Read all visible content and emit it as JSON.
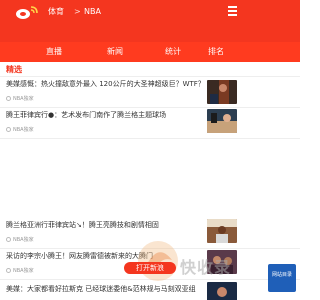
{
  "header": {
    "breadcrumb_section": "体育",
    "breadcrumb_separator": ">",
    "breadcrumb_current": "NBA"
  },
  "tabs": [
    {
      "label": "直播"
    },
    {
      "label": "新闻"
    },
    {
      "label": "统计"
    },
    {
      "label": "排名"
    }
  ],
  "section": {
    "title": "精选"
  },
  "feed": [
    {
      "title": "美媒感慨：热火撞敌意外最入 120公斤的大圣神超级巨？WTF？",
      "source": "NBA独家"
    },
    {
      "title": "腾王菲律宾行●：艺术发布门南作了腾兰格主题球场",
      "source": "NBA独家"
    },
    {
      "title": "腾兰格亚洲行菲律宾站↘！腾王亮腾技和剧情相固",
      "source": "NBA独家"
    },
    {
      "title": "采访的李宗小腾王！网友腾雷德被新来的大腾门",
      "source": "NBA独家"
    },
    {
      "title": "美媒：大家都看好拉斯克 已经球迷委他&范林规与马刻双亚组",
      "source": ""
    }
  ],
  "floating": {
    "open_button": "打开新浪",
    "watermark_text": "快收录",
    "corner_badge": "网站目录"
  },
  "colors": {
    "header_red": "#f4361f",
    "tab_red": "#ff3b1f"
  }
}
